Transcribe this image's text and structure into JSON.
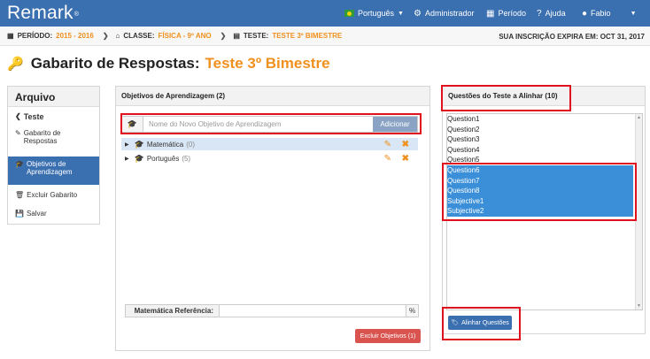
{
  "navbar": {
    "brand": "Remark",
    "brand_mark": "®",
    "language": "Português",
    "user_role": "Administrador",
    "period": "Período",
    "help": "Ajuda",
    "user_name": "Fabio"
  },
  "crumbs": {
    "period_label": "PERÍODO:",
    "period_value": "2015 - 2016",
    "class_label": "CLASSE:",
    "class_value": "FÍSICA - 9º ANO",
    "test_label": "TESTE:",
    "test_value": "TESTE 3º BIMESTRE",
    "expire_label": "SUA INSCRIÇÃO EXPIRA EM:",
    "expire_value": "OCT 31, 2017"
  },
  "page": {
    "title_prefix": "Gabarito de Respostas:",
    "title_highlight": "Teste 3º Bimestre"
  },
  "sidebar": {
    "heading": "Arquivo",
    "items": [
      {
        "label": "Teste"
      },
      {
        "label": "Gabarito de Respostas"
      },
      {
        "label": "Objetivos de Aprendizagem"
      },
      {
        "label": "Excluir Gabarito"
      },
      {
        "label": "Salvar"
      }
    ]
  },
  "objectives": {
    "heading": "Objetivos de Aprendizagem (2)",
    "input_placeholder": "Nome do Novo Objetivo de Aprendizagem",
    "add_label": "Adicionar",
    "items": [
      {
        "name": "Matemática",
        "count": "(0)"
      },
      {
        "name": "Português",
        "count": "(5)"
      }
    ],
    "reference_label": "Matemática Referência:",
    "percent": "%",
    "delete_label": "Excluir Objetivos (1)"
  },
  "questions": {
    "heading": "Questões do Teste a Alinhar (10)",
    "items": [
      {
        "label": "Question1",
        "selected": false
      },
      {
        "label": "Question2",
        "selected": false
      },
      {
        "label": "Question3",
        "selected": false
      },
      {
        "label": "Question4",
        "selected": false
      },
      {
        "label": "Question5",
        "selected": false
      },
      {
        "label": "Question6",
        "selected": true
      },
      {
        "label": "Question7",
        "selected": true
      },
      {
        "label": "Question8",
        "selected": true
      },
      {
        "label": "Subjective1",
        "selected": true
      },
      {
        "label": "Subjective2",
        "selected": true
      }
    ],
    "align_label": "Alinhar Questões"
  },
  "colors": {
    "navbar": "#3a6fb0",
    "accent_orange": "#f0901e",
    "selection_blue": "#3a8fd8",
    "danger": "#d9534f",
    "highlight_red": "#e0121d"
  }
}
